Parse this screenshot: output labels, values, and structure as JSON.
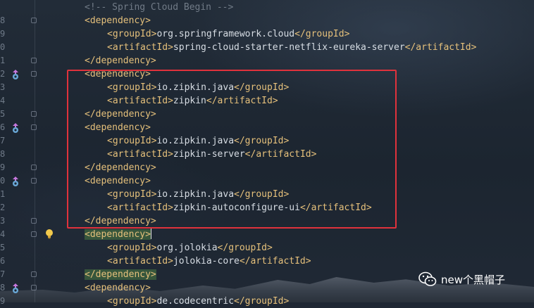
{
  "editor": {
    "lines": [
      {
        "num": "",
        "indent": 0,
        "kind": "comment",
        "text": "<!-- Spring Cloud Begin -->"
      },
      {
        "num": "8",
        "indent": 0,
        "kind": "tag",
        "text": "<dependency>"
      },
      {
        "num": "9",
        "indent": 1,
        "kind": "elem",
        "open": "<groupId>",
        "value": "org.springframework.cloud",
        "close": "</groupId>"
      },
      {
        "num": "0",
        "indent": 1,
        "kind": "elem",
        "open": "<artifactId>",
        "value": "spring-cloud-starter-netflix-eureka-server",
        "close": "</artifactId>"
      },
      {
        "num": "1",
        "indent": 0,
        "kind": "tag",
        "text": "</dependency>"
      },
      {
        "num": "2",
        "indent": 0,
        "kind": "tag",
        "text": "<dependency>"
      },
      {
        "num": "3",
        "indent": 1,
        "kind": "elem",
        "open": "<groupId>",
        "value": "io.zipkin.java",
        "close": "</groupId>"
      },
      {
        "num": "4",
        "indent": 1,
        "kind": "elem",
        "open": "<artifactId>",
        "value": "zipkin",
        "close": "</artifactId>"
      },
      {
        "num": "5",
        "indent": 0,
        "kind": "tag",
        "text": "</dependency>"
      },
      {
        "num": "6",
        "indent": 0,
        "kind": "tag",
        "text": "<dependency>"
      },
      {
        "num": "7",
        "indent": 1,
        "kind": "elem",
        "open": "<groupId>",
        "value": "io.zipkin.java",
        "close": "</groupId>"
      },
      {
        "num": "8",
        "indent": 1,
        "kind": "elem",
        "open": "<artifactId>",
        "value": "zipkin-server",
        "close": "</artifactId>"
      },
      {
        "num": "9",
        "indent": 0,
        "kind": "tag",
        "text": "</dependency>"
      },
      {
        "num": "0",
        "indent": 0,
        "kind": "tag",
        "text": "<dependency>"
      },
      {
        "num": "1",
        "indent": 1,
        "kind": "elem",
        "open": "<groupId>",
        "value": "io.zipkin.java",
        "close": "</groupId>"
      },
      {
        "num": "2",
        "indent": 1,
        "kind": "elem",
        "open": "<artifactId>",
        "value": "zipkin-autoconfigure-ui",
        "close": "</artifactId>"
      },
      {
        "num": "3",
        "indent": 0,
        "kind": "tag",
        "text": "</dependency>"
      },
      {
        "num": "4",
        "indent": 0,
        "kind": "tag",
        "text": "<dependency>"
      },
      {
        "num": "5",
        "indent": 1,
        "kind": "elem",
        "open": "<groupId>",
        "value": "org.jolokia",
        "close": "</groupId>"
      },
      {
        "num": "6",
        "indent": 1,
        "kind": "elem",
        "open": "<artifactId>",
        "value": "jolokia-core",
        "close": "</artifactId>"
      },
      {
        "num": "7",
        "indent": 0,
        "kind": "tag",
        "text": "</dependency>"
      },
      {
        "num": "8",
        "indent": 0,
        "kind": "tag",
        "text": "<dependency>"
      },
      {
        "num": "9",
        "indent": 1,
        "kind": "elem",
        "open": "<groupId>",
        "value": "de.codecentric",
        "close": "</groupId>"
      }
    ],
    "fold_lines": [
      1,
      4,
      5,
      8,
      9,
      12,
      13,
      16,
      17,
      20,
      21
    ],
    "override_marker_lines": [
      5,
      9,
      13,
      21
    ],
    "bulb_line": 17,
    "highlighted_tag_lines": [
      17,
      20
    ]
  },
  "watermark": {
    "text": "new个黑帽子",
    "icon": "wechat-icon"
  },
  "colors": {
    "tag": "#e5c07b",
    "comment": "#717b87",
    "text": "#d7dde4",
    "highlight_box": "#e0323c",
    "match_highlight": "#37563c"
  }
}
